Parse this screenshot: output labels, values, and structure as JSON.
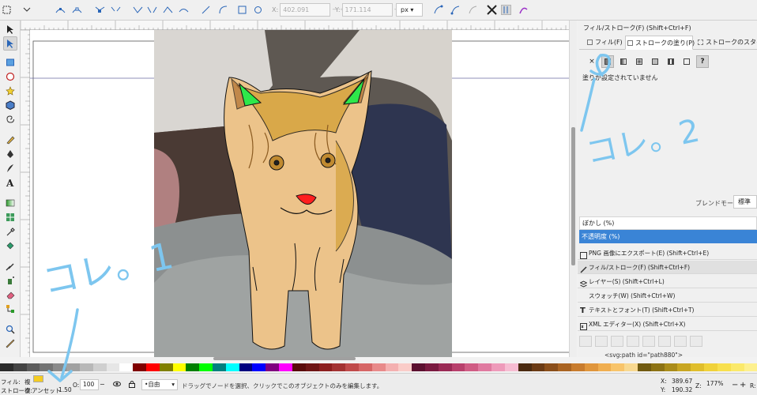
{
  "toolbar": {
    "x_label": "X:",
    "x_value": "402.091",
    "y_label": "Y:",
    "y_value": "171.114",
    "unit": "px",
    "icons": [
      "select-all-icon",
      "select-in-all-layers-icon",
      "insert-node-icon",
      "delete-node-icon",
      "join-nodes-icon",
      "break-path-icon",
      "join-segment-icon",
      "delete-segment-icon",
      "cusp-node-icon",
      "smooth-node-icon",
      "symmetric-node-icon",
      "auto-smooth-node-icon",
      "line-segment-icon",
      "curve-segment-icon",
      "object-to-path-icon",
      "stroke-to-path-icon",
      "show-handles-icon",
      "show-outline-icon",
      "edit-mask-icon"
    ]
  },
  "tools": [
    "selector-tool",
    "node-tool",
    "rectangle-tool",
    "ellipse-tool",
    "star-tool",
    "3d-box-tool",
    "spiral-tool",
    "pencil-tool",
    "pen-tool",
    "calligraphy-tool",
    "text-tool",
    "gradient-tool",
    "mesh-tool",
    "dropper-tool",
    "paint-bucket-tool",
    "tweak-tool",
    "spray-tool",
    "eraser-tool",
    "connector-tool",
    "zoom-tool",
    "measure-tool"
  ],
  "panel": {
    "title": "フィル/ストローク(F) (Shift+Ctrl+F)",
    "tabs": [
      "フィル(F)",
      "ストロークの塗り(P)",
      "ストロークのスタイル(Y)"
    ],
    "no_paint_text": "塗りが設定されていません",
    "blend_label": "ブレンドモード:",
    "blend_value": "標準",
    "blur_label": "ぼかし (%)",
    "opacity_label": "不透明度 (%)"
  },
  "dock": [
    {
      "label": "PNG 画像にエクスポート(E) (Shift+Ctrl+E)",
      "icon": "png-export-icon"
    },
    {
      "label": "フィル/ストローク(F) (Shift+Ctrl+F)",
      "icon": "fill-stroke-icon"
    },
    {
      "label": "レイヤー(S) (Shift+Ctrl+L)",
      "icon": "layers-icon"
    },
    {
      "label": "スウォッチ(W) (Shift+Ctrl+W)",
      "icon": ""
    },
    {
      "label": "テキストとフォント(T) (Shift+Ctrl+T)",
      "icon": "text-font-icon"
    },
    {
      "label": "XML エディター(X) (Shift+Ctrl+X)",
      "icon": "xml-editor-icon"
    }
  ],
  "xml_node": "<svg:path id=\"path880\">",
  "palette": [
    "#2b2b2b",
    "#444444",
    "#5c5c5c",
    "#737373",
    "#8a8a8a",
    "#a1a1a1",
    "#b8b8b8",
    "#cfcfcf",
    "#e6e6e6",
    "#ffffff",
    "#800000",
    "#ff0000",
    "#808000",
    "#ffff00",
    "#008000",
    "#00ff00",
    "#008080",
    "#00ffff",
    "#000080",
    "#0000ff",
    "#800080",
    "#ff00ff",
    "#5a0a0a",
    "#6e1414",
    "#8c1e1e",
    "#a33232",
    "#c04a4a",
    "#d66666",
    "#e88a8a",
    "#f4b0b0",
    "#faccc8",
    "#5c1030",
    "#7a1a40",
    "#9a2a55",
    "#b8406c",
    "#d05c84",
    "#e07aa0",
    "#ee9aba",
    "#f6bcd2",
    "#4a2a10",
    "#6a3a14",
    "#8a4e1a",
    "#aa6422",
    "#c87c2e",
    "#e0963c",
    "#f0ae50",
    "#f8c46a",
    "#f8d890",
    "#705a10",
    "#8c7214",
    "#aa8c1a",
    "#c8a622",
    "#e0be2c",
    "#f0d23a",
    "#f8e04e",
    "#fbe96a",
    "#fdf08e"
  ],
  "status": {
    "fill_label": "フィル:",
    "fill_value": "複",
    "stroke_label": "ストローク:",
    "stroke_value": "複",
    "asset_text": "アンセット",
    "stroke_width": "1.50",
    "opacity_label": "O:",
    "opacity_value": "100",
    "layer_value": "•自由",
    "message": "ドラッグでノードを選択、クリックでこのオブジェクトのみを編集します。",
    "x_label": "X:",
    "x_value": "389.67",
    "y_label": "Y:",
    "y_value": "190.32",
    "zoom_label": "Z:",
    "zoom_value": "177%",
    "rotate_label": "R:"
  },
  "annotations": {
    "label1": "コレ。1",
    "label2": "コレ。2",
    "color": "#7dc6ef"
  }
}
